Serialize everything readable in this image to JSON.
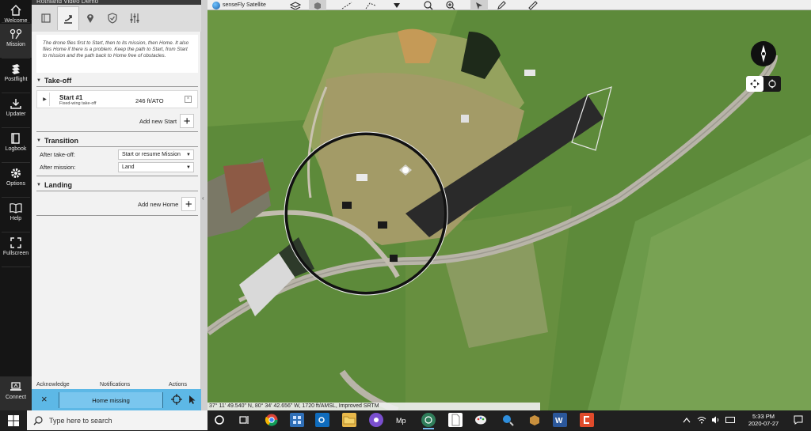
{
  "nav": {
    "items": [
      {
        "label": "Welcome",
        "icon": "home-icon"
      },
      {
        "label": "Mission",
        "icon": "waypoints-icon"
      },
      {
        "label": "Postflight",
        "icon": "stack-icon"
      },
      {
        "label": "Updater",
        "icon": "download-icon"
      },
      {
        "label": "Logbook",
        "icon": "book-icon"
      },
      {
        "label": "Options",
        "icon": "gear-icon"
      },
      {
        "label": "Help",
        "icon": "book-open-icon"
      },
      {
        "label": "Fullscreen",
        "icon": "expand-icon"
      }
    ],
    "connect_label": "Connect"
  },
  "panel": {
    "title": "Rothland Video Demo",
    "intro": "The drone flies first to Start, then to its mission, then Home. It also flies Home if there is a problem. Keep the path to Start, from Start to mission and the path back to Home free of obstacles.",
    "takeoff": {
      "heading": "Take-off",
      "start_name": "Start #1",
      "start_type": "Fixed-wing take-off",
      "start_altitude": "246 ft/ATO",
      "add_label": "Add new Start"
    },
    "transition": {
      "heading": "Transition",
      "after_takeoff_label": "After take-off:",
      "after_takeoff_value": "Start or resume Mission",
      "after_mission_label": "After mission:",
      "after_mission_value": "Land"
    },
    "landing": {
      "heading": "Landing",
      "add_label": "Add new Home"
    },
    "footer": {
      "acknowledge": "Acknowledge",
      "notifications": "Notifications",
      "actions": "Actions",
      "message": "Home missing"
    }
  },
  "map": {
    "basemap": "senseFly Satellite",
    "status": "37° 11' 49.540\" N, 80° 34' 42.656\" W, 1720 ft/AMSL, Improved SRTM"
  },
  "taskbar": {
    "search_placeholder": "Type here to search",
    "time": "5:33 PM",
    "date": "2020-07-27",
    "colors": {
      "accent": "#76b9ed"
    }
  }
}
